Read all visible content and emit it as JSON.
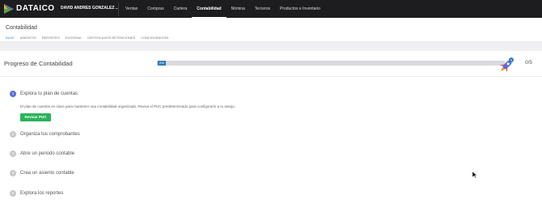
{
  "topbar": {
    "brand": "DATAICO",
    "company": "DAVID ANDRES GONZALEZ ...",
    "nav": [
      "Ventas",
      "Compras",
      "Cartera",
      "Contabilidad",
      "Nómina",
      "Terceros",
      "Productos e Inventario"
    ],
    "active_nav": "Contabilidad"
  },
  "page": {
    "title": "Contabilidad",
    "subnav": [
      "BASE",
      "ASIENTOS",
      "REPORTES",
      "EXOGENA",
      "CERTIFICADOS RETENCIONES",
      "CONFIGURACIÓN"
    ],
    "active_subnav": "BASE"
  },
  "progress": {
    "title": "Progreso de Contabilidad",
    "percent_label": "0%",
    "percent": 0,
    "count": "0/5",
    "rocket_badge": "0"
  },
  "steps": [
    {
      "number": "1",
      "label": "Explora tu plan de cuentas",
      "active": true
    },
    {
      "number": "2",
      "label": "Organiza tus comprobantes",
      "active": false
    },
    {
      "number": "3",
      "label": "Abre un periodo contable",
      "active": false
    },
    {
      "number": "4",
      "label": "Crea un asiento contable",
      "active": false
    },
    {
      "number": "5",
      "label": "Explora los reportes",
      "active": false
    }
  ],
  "step1_detail": {
    "description": "El plan de cuentas es clave para mantener una contabilidad organizada. Revisa el PUC predeterminado para configurarlo a tu antojo.",
    "button": "Revisar PUC"
  },
  "colors": {
    "topbar": "#1d1d1f",
    "accent_blue": "#2f7bbf",
    "step_active": "#5a6fd6",
    "button_green": "#29b35a"
  }
}
